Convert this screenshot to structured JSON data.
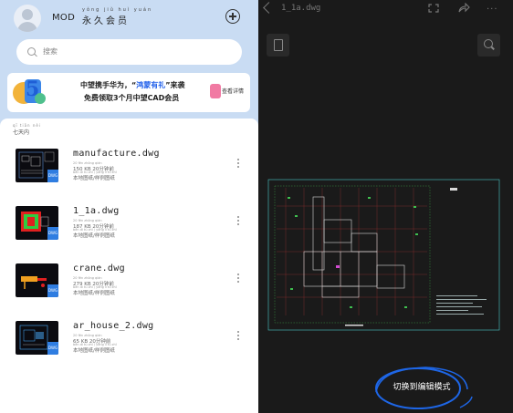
{
  "header": {
    "username": "MOD",
    "member_pinyin": "yǒng jiǔ huì yuán",
    "member_label": "永久会员"
  },
  "search": {
    "placeholder": "搜索"
  },
  "banner": {
    "line1_prefix": "中望携手华为，“",
    "line1_highlight": "鸿蒙有礼",
    "line1_suffix": "”来袭",
    "line2": "免费领取3个月中望CAD会员",
    "detail_label": "查看详情",
    "five_digit": "5"
  },
  "section": {
    "pinyin": "qī tiān nèi",
    "label": "七天内"
  },
  "files": [
    {
      "name": "manufacture.dwg",
      "size": "150 KB",
      "time_py": "20 fēn zhōng qián",
      "time": "20分钟前",
      "loc_py": "běn dì tú zhǐ / yàng lì tú zhǐ",
      "location": "本地图纸/样例图纸",
      "badge": "DWG"
    },
    {
      "name": "1_1a.dwg",
      "size": "187 KB",
      "time_py": "20 fēn zhōng qián",
      "time": "20分钟前",
      "loc_py": "běn dì tú zhǐ / yàng lì tú zhǐ",
      "location": "本地图纸/样例图纸",
      "badge": "DWG"
    },
    {
      "name": "crane.dwg",
      "size": "279 KB",
      "time_py": "20 fēn zhōng qián",
      "time": "20分钟前",
      "loc_py": "běn dì tú zhǐ / yàng lì tú zhǐ",
      "location": "本地图纸/样例图纸",
      "badge": "DWG"
    },
    {
      "name": "ar_house_2.dwg",
      "size": "65 KB",
      "time_py": "20 fēn zhōng qián",
      "time": "20分钟前",
      "loc_py": "běn dì tú zhǐ / yàng lì tú zhǐ",
      "location": "本地图纸/样例图纸",
      "badge": "DWG"
    }
  ],
  "viewer": {
    "title": "1_1a.dwg",
    "more_label": "···",
    "edit_mode_label": "切换到编辑模式"
  },
  "colors": {
    "header_bg": "#c9dcf3",
    "accent": "#2f7de1",
    "viewer_bg": "#1a1a1a",
    "highlight_ring": "#1e66e6",
    "drawing_red": "#d23a3a",
    "drawing_green": "#3fbf4f",
    "drawing_cyan": "#49c9c9"
  }
}
